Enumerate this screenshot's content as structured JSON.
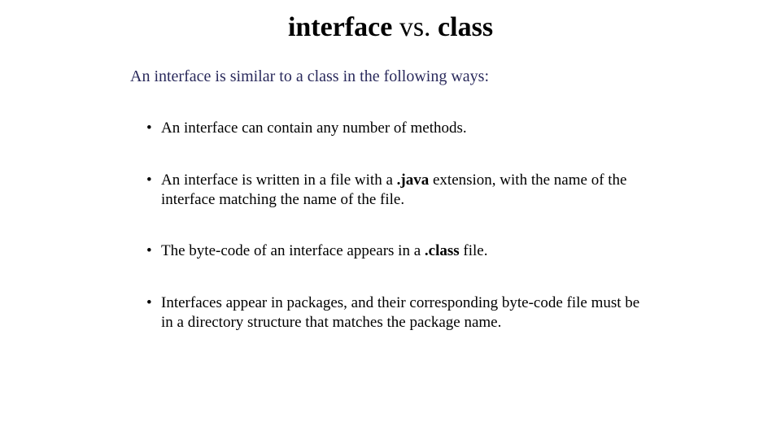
{
  "title": {
    "kw1": "interface",
    "sep": " vs. ",
    "kw2": "class"
  },
  "intro": "An interface is similar to a class in the following ways:",
  "bullets": {
    "b1": "An interface can contain any number of methods.",
    "b2_pre": "An interface is written in a file with a ",
    "b2_bold": ".java",
    "b2_post": " extension, with the name of the interface matching the name of the file.",
    "b3_pre": "The byte-code of an interface appears in a ",
    "b3_bold": ".class",
    "b3_post": " file.",
    "b4": "Interfaces appear in packages, and their corresponding byte-code file must be in a directory structure that matches the package name."
  }
}
